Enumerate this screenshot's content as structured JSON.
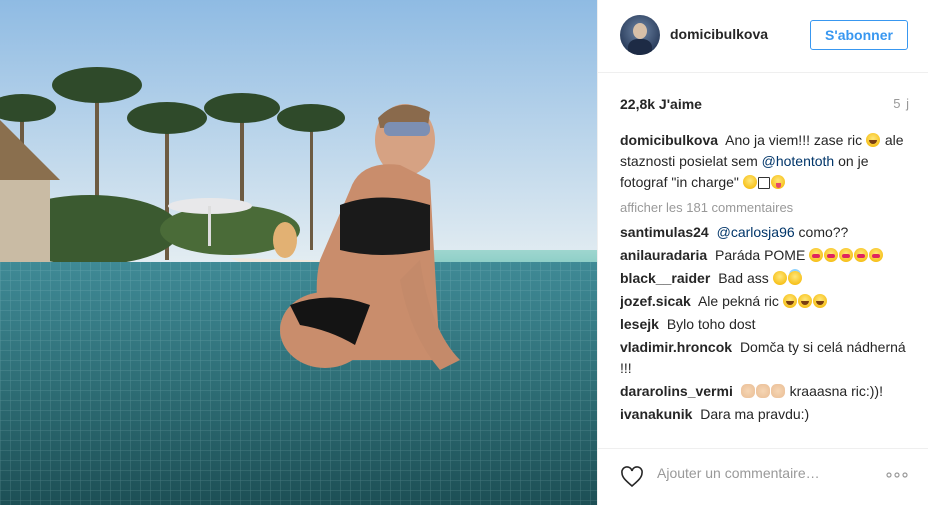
{
  "header": {
    "username": "domicibulkova",
    "follow_label": "S'abonner"
  },
  "stats": {
    "likes": "22,8k J'aime",
    "age": "5 j"
  },
  "caption": {
    "username": "domicibulkova",
    "text_1": "Ano ja viem!!! zase ric",
    "text_2": "ale staznosti posielat sem",
    "mention": "@hotentoth",
    "text_3": "on je fotograf \"in charge\""
  },
  "view_all_label": "afficher les 181 commentaires",
  "comments": [
    {
      "user": "santimulas24",
      "mention": "@carlosja96",
      "text": "como??"
    },
    {
      "user": "anilauradaria",
      "text": "Paráda POME"
    },
    {
      "user": "black__raider",
      "text": "Bad ass"
    },
    {
      "user": "jozef.sicak",
      "text": "Ale pekná ric"
    },
    {
      "user": "lesejk",
      "text": "Bylo toho dost"
    },
    {
      "user": "vladimir.hroncok",
      "text": "Domča ty si celá nádherná !!!"
    },
    {
      "user": "dararolins_vermi",
      "text": "kraaasna ric:))!"
    },
    {
      "user": "ivanakunik",
      "text": "Dara ma pravdu:)"
    }
  ],
  "footer": {
    "add_comment_placeholder": "Ajouter un commentaire…"
  },
  "icons": {
    "like": "heart-outline-icon",
    "options": "more-options-icon"
  },
  "colors": {
    "accent": "#3897f0",
    "mention": "#003569",
    "muted": "#999999",
    "text": "#262626"
  }
}
